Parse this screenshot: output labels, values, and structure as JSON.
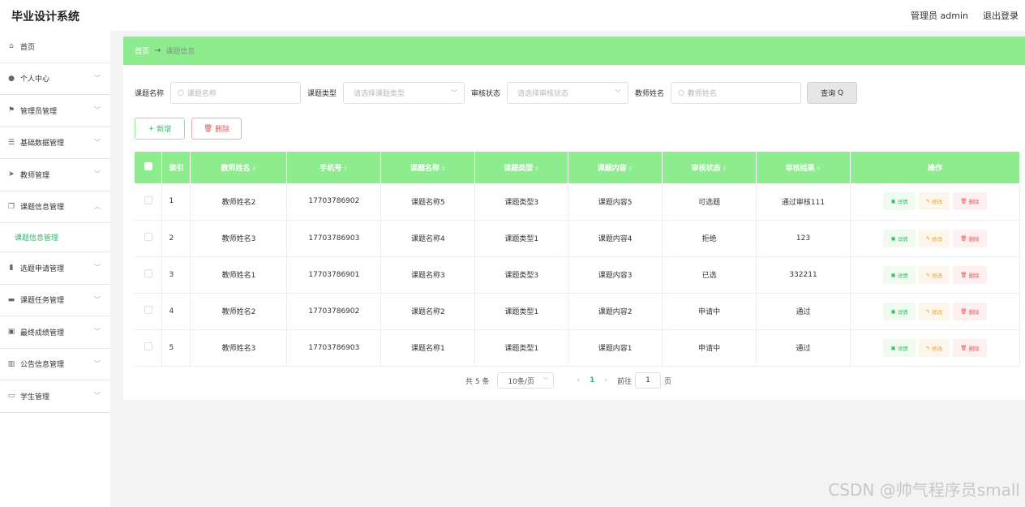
{
  "app": {
    "title": "毕业设计系统",
    "user": "管理员 admin",
    "logout": "退出登录"
  },
  "sidebar": {
    "items": [
      {
        "label": "首页"
      },
      {
        "label": "个人中心"
      },
      {
        "label": "管理员管理"
      },
      {
        "label": "基础数据管理"
      },
      {
        "label": "教师管理"
      },
      {
        "label": "课题信息管理"
      },
      {
        "label": "选题申请管理"
      },
      {
        "label": "课题任务管理"
      },
      {
        "label": "最终成绩管理"
      },
      {
        "label": "公告信息管理"
      },
      {
        "label": "学生管理"
      }
    ],
    "sub": "课题信息管理"
  },
  "breadcrumb": {
    "home": "首页",
    "current": "课题信息"
  },
  "filters": {
    "title_label": "课题名称",
    "title_ph": "课题名称",
    "type_label": "课题类型",
    "type_ph": "请选择课题类型",
    "status_label": "审核状态",
    "status_ph": "请选择审核状态",
    "teacher_label": "教师姓名",
    "teacher_ph": "教师姓名",
    "query": "查询"
  },
  "actions": {
    "add": "新增",
    "delete": "删除"
  },
  "table": {
    "headers": [
      "索引",
      "教师姓名",
      "手机号",
      "课题名称",
      "课题类型",
      "课题内容",
      "审核状态",
      "审核结果",
      "操作"
    ],
    "rows": [
      {
        "idx": "1",
        "teacher": "教师姓名2",
        "phone": "17703786902",
        "name": "课题名称5",
        "type": "课题类型3",
        "content": "课题内容5",
        "status": "可选题",
        "result": "通过审核111"
      },
      {
        "idx": "2",
        "teacher": "教师姓名3",
        "phone": "17703786903",
        "name": "课题名称4",
        "type": "课题类型1",
        "content": "课题内容4",
        "status": "拒绝",
        "result": "123"
      },
      {
        "idx": "3",
        "teacher": "教师姓名1",
        "phone": "17703786901",
        "name": "课题名称3",
        "type": "课题类型3",
        "content": "课题内容3",
        "status": "已选",
        "result": "332211"
      },
      {
        "idx": "4",
        "teacher": "教师姓名2",
        "phone": "17703786902",
        "name": "课题名称2",
        "type": "课题类型1",
        "content": "课题内容2",
        "status": "申请中",
        "result": "通过"
      },
      {
        "idx": "5",
        "teacher": "教师姓名3",
        "phone": "17703786903",
        "name": "课题名称1",
        "type": "课题类型1",
        "content": "课题内容1",
        "status": "申请中",
        "result": "通过"
      }
    ],
    "ops": {
      "detail": "详情",
      "edit": "修改",
      "delete": "删除"
    }
  },
  "pager": {
    "total": "共 5 条",
    "size": "10条/页",
    "page": "1",
    "goto": "前往",
    "goto_value": "1",
    "unit": "页"
  },
  "watermark": "CSDN @帅气程序员small"
}
